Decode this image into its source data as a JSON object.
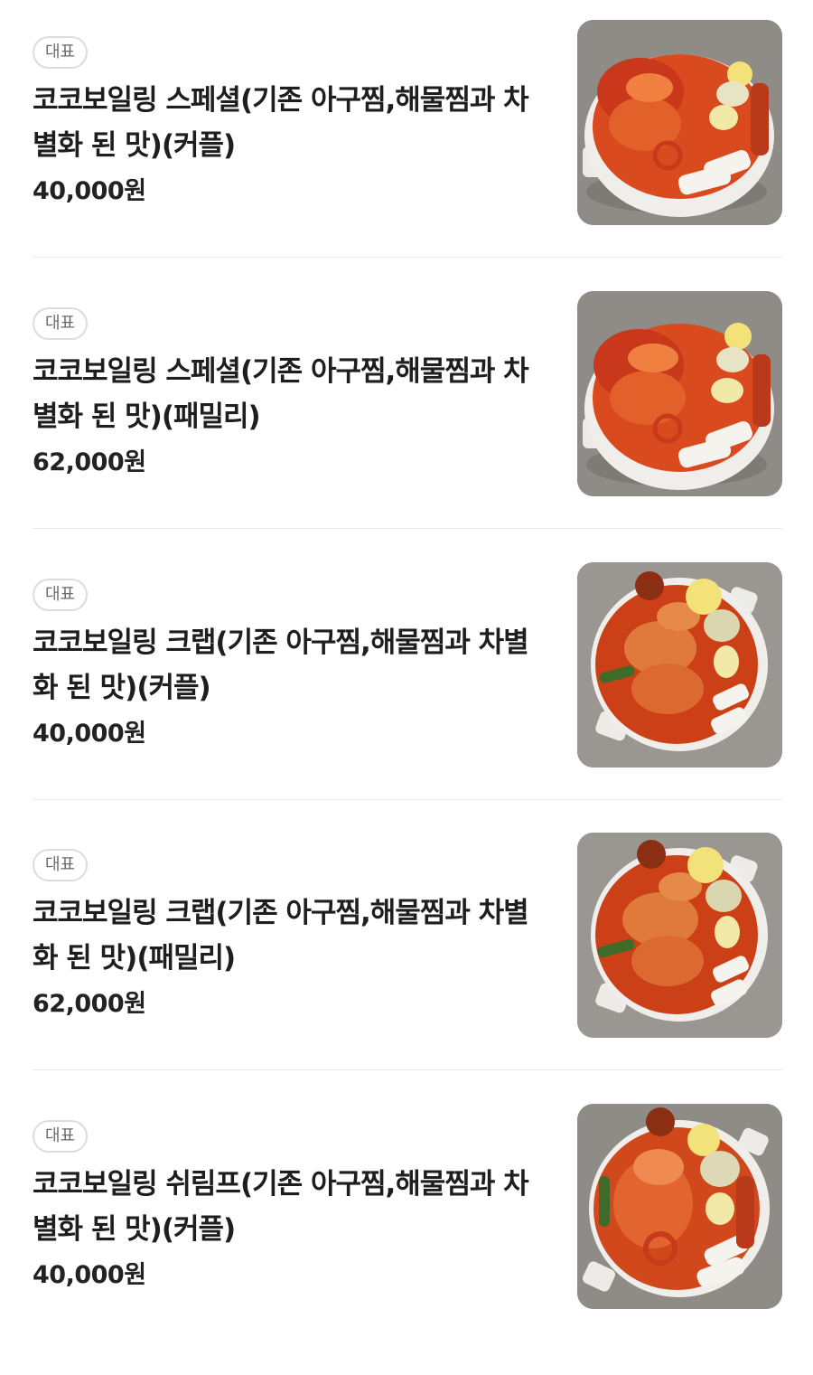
{
  "menu": {
    "items": [
      {
        "badge": "대표",
        "title": "코코보일링 스페셜(기존 아구찜,해물찜과 차별화 된 맛)(커플)",
        "price": "40,000원",
        "photo": "seafood-boil-special-photo"
      },
      {
        "badge": "대표",
        "title": "코코보일링 스페셜(기존 아구찜,해물찜과 차별화 된 맛)(패밀리)",
        "price": "62,000원",
        "photo": "seafood-boil-special-photo"
      },
      {
        "badge": "대표",
        "title": "코코보일링 크랩(기존 아구찜,해물찜과 차별화 된 맛)(커플)",
        "price": "40,000원",
        "photo": "seafood-boil-crab-photo"
      },
      {
        "badge": "대표",
        "title": "코코보일링 크랩(기존 아구찜,해물찜과 차별화 된 맛)(패밀리)",
        "price": "62,000원",
        "photo": "seafood-boil-crab-photo"
      },
      {
        "badge": "대표",
        "title": "코코보일링 쉬림프(기존 아구찜,해물찜과 차별화 된 맛)(커플)",
        "price": "40,000원",
        "photo": "seafood-boil-shrimp-photo"
      }
    ]
  },
  "colors": {
    "background": "#ffffff",
    "badge_border": "#dcdcdc",
    "badge_text": "#6b6b6b",
    "divider": "#e9e9e9",
    "photo_backdrop": "#8d8985",
    "sauce": "#d9451c"
  }
}
